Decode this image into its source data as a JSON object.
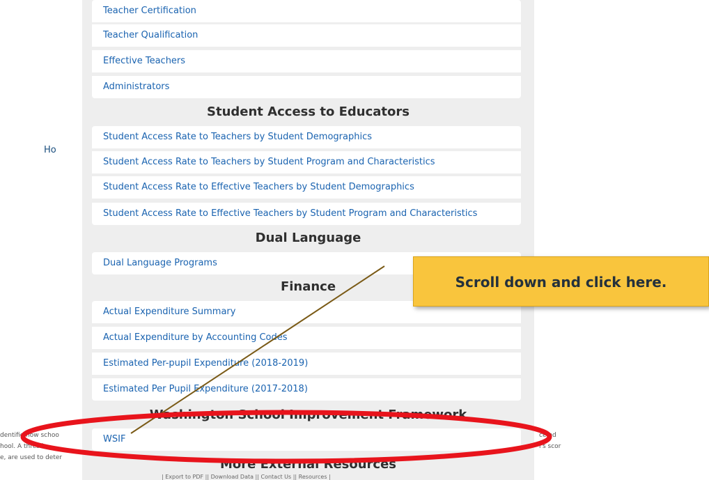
{
  "educator_links": [
    "Teacher Certification",
    "Teacher Qualification",
    "Effective Teachers",
    "Administrators"
  ],
  "sections": {
    "access": {
      "heading": "Student Access to Educators",
      "links": [
        "Student Access Rate to Teachers by Student Demographics",
        "Student Access Rate to Teachers by Student Program and Characteristics",
        "Student Access Rate to Effective Teachers by Student Demographics",
        "Student Access Rate to Effective Teachers by Student Program and Characteristics"
      ]
    },
    "dual": {
      "heading": "Dual Language",
      "links": [
        "Dual Language Programs"
      ]
    },
    "finance": {
      "heading": "Finance",
      "links": [
        "Actual Expenditure Summary",
        "Actual Expenditure by Accounting Codes",
        "Estimated Per-pupil Expenditure (2018-2019)",
        "Estimated Per Pupil Expenditure (2017-2018)"
      ]
    },
    "wsif": {
      "heading": "Washington School Improvement Framework",
      "links": [
        "WSIF"
      ]
    },
    "external": {
      "heading": "More External Resources"
    }
  },
  "callout_text": "Scroll down and click here.",
  "background": {
    "how_text": "Ho",
    "left_lines": [
      "dentifie how schoo",
      "hool. A thres is",
      "e, are used to deter"
    ],
    "right_lines": [
      "ce nd",
      "l's scor"
    ],
    "bottom_bar": "| Export to PDF || Download Data || Contact Us || Resources |"
  },
  "colors": {
    "link": "#1a63b0",
    "callout": "#f9c53d",
    "highlight_ellipse": "#e8141c",
    "pointer_line": "#7a5a16"
  }
}
